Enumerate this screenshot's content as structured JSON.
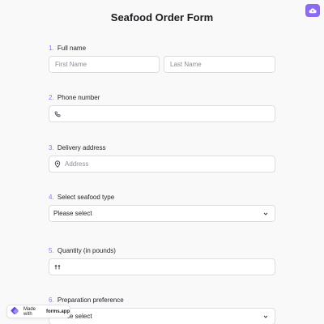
{
  "form": {
    "title": "Seafood Order Form",
    "questions": [
      {
        "number": "1.",
        "label": "Full name",
        "first_placeholder": "First Name",
        "last_placeholder": "Last Name"
      },
      {
        "number": "2.",
        "label": "Phone number",
        "value": ""
      },
      {
        "number": "3.",
        "label": "Delivery address",
        "placeholder": "Address"
      },
      {
        "number": "4.",
        "label": "Select seafood type",
        "selected": "Please select"
      },
      {
        "number": "5.",
        "label": "Quantity (in pounds)",
        "value": ""
      },
      {
        "number": "6.",
        "label": "Preparation preference",
        "selected": "Please select"
      }
    ]
  },
  "badge": {
    "prefix": "Made with",
    "brand": "forms.app"
  },
  "colors": {
    "accent": "#8f74ee",
    "corner_button": "#8b6cf0",
    "background": "#f9f9fa"
  },
  "icons": {
    "corner": "cloud-upload-icon",
    "phone": "phone-icon",
    "address": "location-pin-icon",
    "quantity": "number-icon",
    "select": "chevron-down-icon",
    "logo": "forms-app-logo-icon"
  }
}
